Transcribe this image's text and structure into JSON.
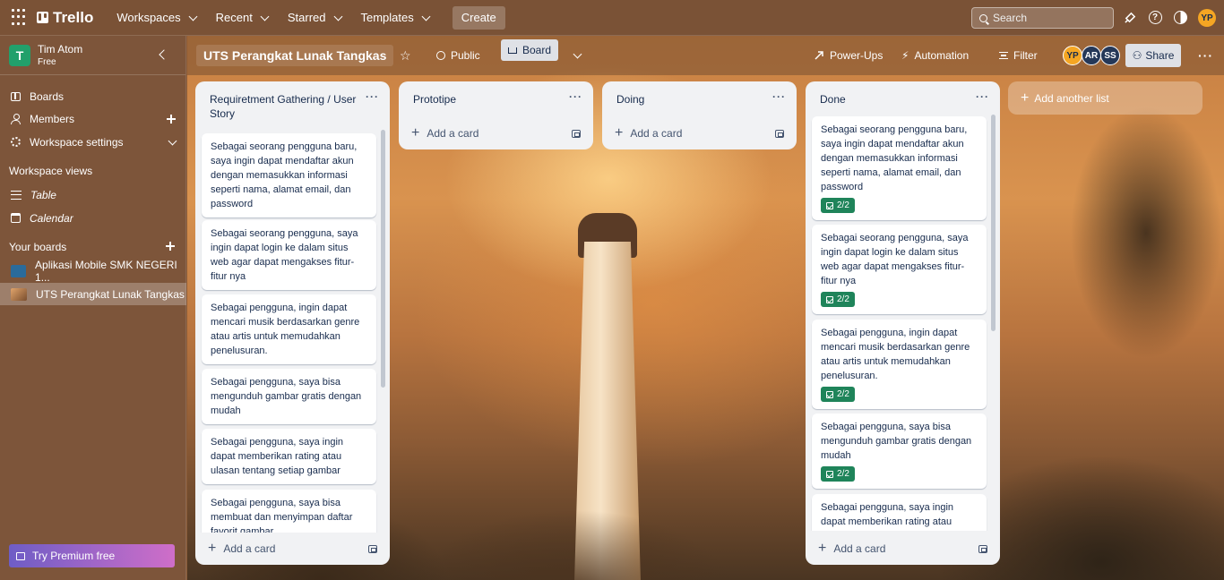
{
  "topnav": {
    "logo": "Trello",
    "menus": [
      "Workspaces",
      "Recent",
      "Starred",
      "Templates"
    ],
    "create_label": "Create",
    "search_placeholder": "Search",
    "user_initials": "YP",
    "icons": [
      "apps-grid-icon",
      "notifications-icon",
      "help-icon",
      "theme-icon"
    ]
  },
  "sidebar": {
    "workspace_initial": "T",
    "workspace_name": "Tim Atom",
    "workspace_plan": "Free",
    "items": [
      {
        "label": "Boards",
        "icon": "board-icon"
      },
      {
        "label": "Members",
        "icon": "person-icon"
      },
      {
        "label": "Workspace settings",
        "icon": "gear-icon"
      }
    ],
    "views_heading": "Workspace views",
    "views": [
      {
        "label": "Table",
        "icon": "table-icon"
      },
      {
        "label": "Calendar",
        "icon": "calendar-icon"
      }
    ],
    "boards_heading": "Your boards",
    "boards": [
      {
        "label": "Aplikasi Mobile SMK NEGERI 1...",
        "color": "#2a6b9b"
      },
      {
        "label": "UTS Perangkat Lunak Tangkas",
        "color": "#c98a55",
        "active": true
      }
    ],
    "premium_label": "Try Premium free"
  },
  "board": {
    "title": "UTS Perangkat Lunak Tangkas",
    "visibility": "Public",
    "view": "Board",
    "power_ups": "Power-Ups",
    "automation": "Automation",
    "filter": "Filter",
    "members": [
      "YP",
      "AR",
      "SS"
    ],
    "share": "Share",
    "add_list": "Add another list",
    "add_card": "Add a card"
  },
  "lists": [
    {
      "title": "Requiretment Gathering / User Story",
      "cards": [
        "Sebagai seorang pengguna baru, saya ingin dapat mendaftar akun dengan memasukkan informasi seperti nama, alamat email, dan password",
        "Sebagai seorang pengguna, saya ingin dapat login ke dalam situs web agar dapat mengakses fitur-fitur nya",
        "Sebagai pengguna, ingin dapat mencari musik berdasarkan genre atau artis untuk memudahkan penelusuran.",
        "Sebagai pengguna, saya bisa mengunduh gambar gratis dengan mudah",
        "Sebagai pengguna, saya ingin dapat memberikan rating atau ulasan tentang setiap gambar",
        "Sebagai pengguna, saya bisa membuat dan menyimpan daftar favorit gambar"
      ]
    },
    {
      "title": "Prototipe",
      "cards": []
    },
    {
      "title": "Doing",
      "cards": []
    },
    {
      "title": "Done",
      "cards": [
        "Sebagai seorang pengguna baru, saya ingin dapat mendaftar akun dengan memasukkan informasi seperti nama, alamat email, dan password",
        "Sebagai seorang pengguna, saya ingin dapat login ke dalam situs web agar dapat mengakses fitur-fitur nya",
        "Sebagai pengguna, ingin dapat mencari musik berdasarkan genre atau artis untuk memudahkan penelusuran.",
        "Sebagai pengguna, saya bisa mengunduh gambar gratis dengan mudah",
        "Sebagai pengguna, saya ingin dapat memberikan rating atau"
      ],
      "checklist_badge": "2/2"
    }
  ]
}
